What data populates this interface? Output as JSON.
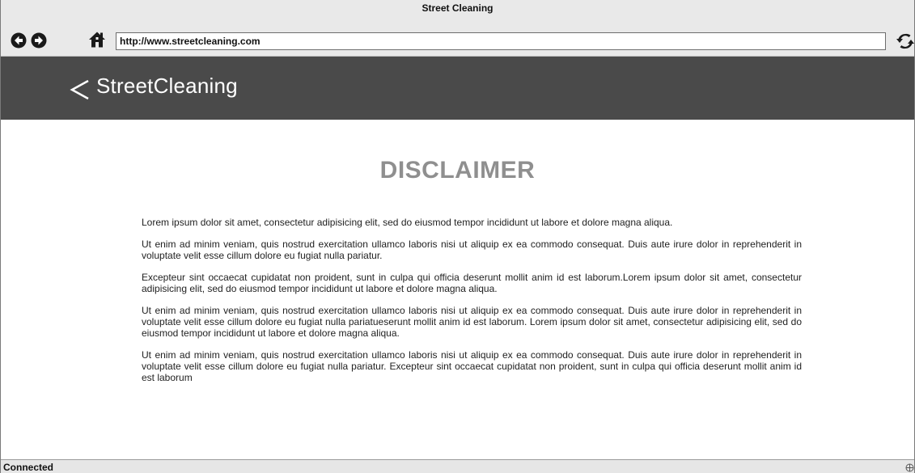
{
  "window": {
    "title": "Street Cleaning"
  },
  "browser": {
    "url": "http://www.streetcleaning.com",
    "icons": {
      "back": "arrow-left-circle-icon",
      "forward": "arrow-right-circle-icon",
      "home": "home-icon",
      "refresh": "refresh-icon"
    }
  },
  "header": {
    "back_icon": "chevron-left-icon",
    "title": "StreetCleaning",
    "background": "#4a4a4a"
  },
  "main": {
    "title": "DISCLAIMER",
    "title_color": "#8f8f8f",
    "paragraphs": [
      "Lorem ipsum dolor sit amet, consectetur adipisicing elit, sed do eiusmod tempor incididunt ut labore et dolore magna aliqua.",
      "Ut enim ad minim veniam, quis nostrud exercitation ullamco laboris nisi ut aliquip ex ea commodo consequat. Duis aute irure dolor in reprehenderit in voluptate velit esse cillum dolore eu fugiat nulla pariatur.",
      "Excepteur sint occaecat cupidatat non proident, sunt in culpa qui officia deserunt mollit anim id est laborum.Lorem ipsum dolor sit amet, consectetur adipisicing elit, sed do eiusmod tempor incididunt ut labore et dolore magna aliqua.",
      "Ut enim ad minim veniam, quis nostrud exercitation ullamco laboris nisi ut aliquip ex ea commodo consequat. Duis aute irure dolor in reprehenderit in voluptate velit esse cillum dolore eu fugiat nulla pariatueserunt mollit anim id est laborum. Lorem ipsum dolor sit amet, consectetur adipisicing elit, sed do eiusmod tempor incididunt ut labore et dolore magna aliqua.",
      "Ut enim ad minim veniam, quis nostrud exercitation ullamco laboris nisi ut aliquip ex ea commodo consequat. Duis aute irure dolor in reprehenderit in voluptate velit esse cillum dolore eu fugiat nulla pariatur. Excepteur sint occaecat cupidatat non proident, sunt in culpa qui officia deserunt mollit anim id est laborum"
    ]
  },
  "status_bar": {
    "text": "Connected",
    "icon": "network-icon"
  }
}
